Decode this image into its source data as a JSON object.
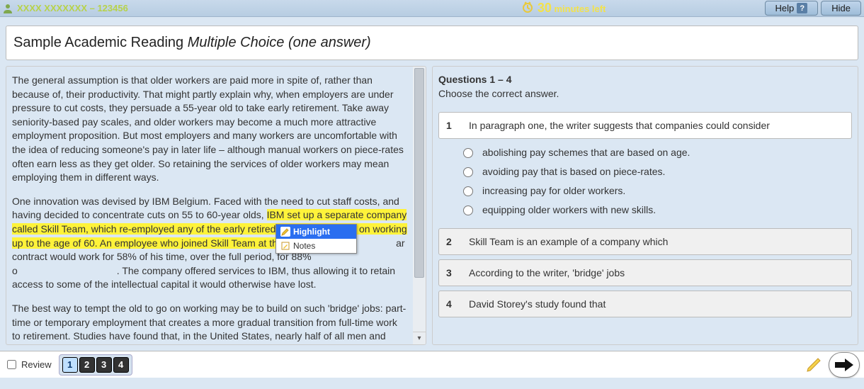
{
  "header": {
    "user_label": "XXXX XXXXXXX – 123456",
    "timer_num": "30",
    "timer_rest": " minutes left",
    "help": "Help",
    "hide": "Hide"
  },
  "title": {
    "plain": "Sample Academic Reading ",
    "italic": "Multiple Choice (one answer)"
  },
  "passage": {
    "p1": "The general assumption is that older workers are paid more in spite of, rather than because of, their productivity. That might partly explain why, when employers are under pressure to cut costs, they persuade a 55-year old to take early retirement. Take away seniority-based pay scales, and older workers may become a much more attractive employment proposition. But most employers and many workers are uncomfortable with the idea of reducing someone's pay in later life – although manual workers on piece-rates often earn less as they get older. So retaining the services of older workers may mean employing them in different ways.",
    "p2_pre": "One innovation was devised by IBM Belgium. Faced with the need to cut staff costs, and having decided to concentrate cuts on 55 to 60-year olds, ",
    "p2_hl": "IBM set up a separate company called Skill Team, which re-employed any of the early retired who wanted to go on working up to the age of 60. An employee who joined Skill Team at the ag",
    "p2_post_a": "ar contract would work for 58% of his time, over the full period, for 88% o",
    "p2_post_b": ". The company offered services to IBM, thus allowing it to retain access to some of the intellectual capital it would otherwise have lost.",
    "p3": "The best way to tempt the old to go on working may be to build on such 'bridge' jobs: part-time or temporary employment that creates a more gradual transition from full-time work to retirement. Studies have found that, in the United States, nearly half of all men and women who had been in full-time jobs in middle age moved into such 'bridge' jobs at the end of their"
  },
  "context_menu": {
    "highlight": "Highlight",
    "notes": "Notes"
  },
  "qpanel": {
    "heading": "Questions 1 – 4",
    "instruction": "Choose the correct answer.",
    "q1": {
      "num": "1",
      "text": "In paragraph one, the writer suggests that companies could consider",
      "opts": [
        "abolishing pay schemes that are based on age.",
        "avoiding pay that is based on piece-rates.",
        "increasing pay for older workers.",
        "equipping older workers with new skills."
      ]
    },
    "q2": {
      "num": "2",
      "text": "Skill Team is an example of a company which"
    },
    "q3": {
      "num": "3",
      "text": "According to the writer, 'bridge' jobs"
    },
    "q4": {
      "num": "4",
      "text": "David Storey's study found that"
    }
  },
  "bottom": {
    "review": "Review",
    "nav": [
      "1",
      "2",
      "3",
      "4"
    ]
  }
}
